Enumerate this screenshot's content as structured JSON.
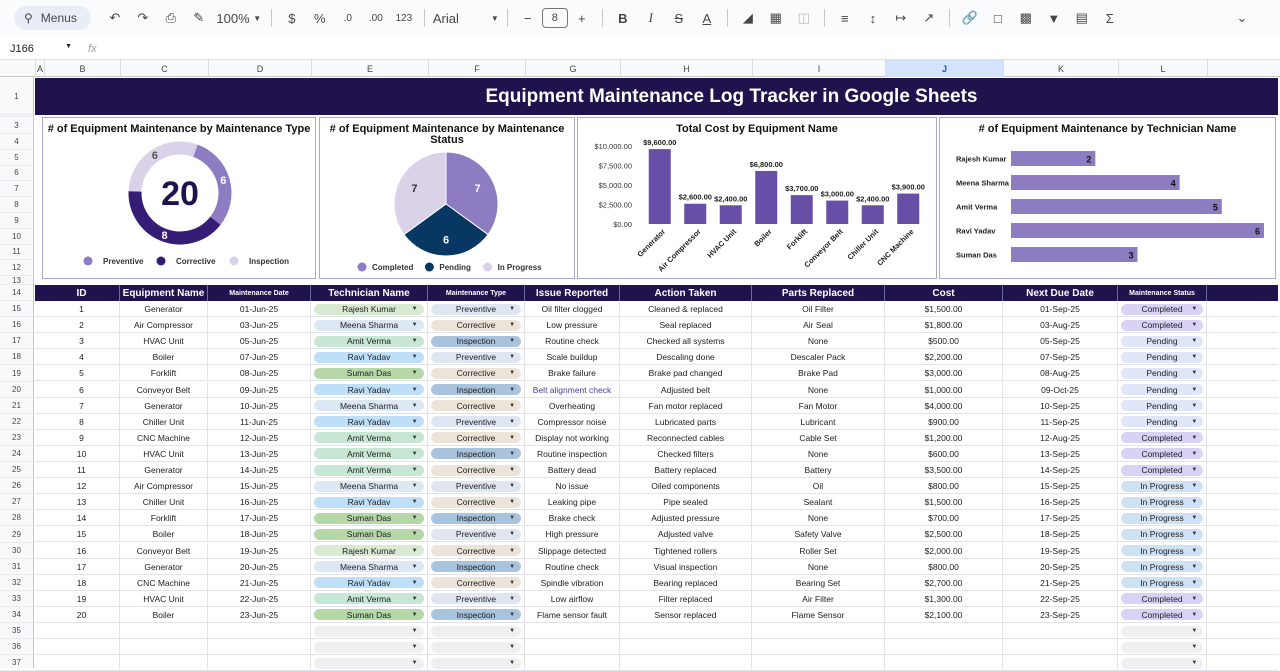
{
  "toolbar": {
    "menus_label": "Menus",
    "zoom": "100%",
    "currency": "$",
    "percent": "%",
    "decrease_decimal": ".0",
    "increase_decimal": ".00",
    "number_format": "123",
    "font": "Arial",
    "font_size": "8"
  },
  "formula_bar": {
    "cell_ref": "J166",
    "fx": "fx"
  },
  "columns": [
    {
      "letter": "A",
      "w": 9
    },
    {
      "letter": "B",
      "w": 76
    },
    {
      "letter": "C",
      "w": 88
    },
    {
      "letter": "D",
      "w": 103
    },
    {
      "letter": "E",
      "w": 117
    },
    {
      "letter": "F",
      "w": 97
    },
    {
      "letter": "G",
      "w": 95
    },
    {
      "letter": "H",
      "w": 132
    },
    {
      "letter": "I",
      "w": 133
    },
    {
      "letter": "J",
      "w": 118
    },
    {
      "letter": "K",
      "w": 115
    },
    {
      "letter": "L",
      "w": 89
    },
    {
      "letter": "",
      "w": 88
    }
  ],
  "selected_column": "J",
  "title": "Equipment Maintenance Log Tracker in Google Sheets",
  "charts": {
    "type_donut": {
      "title": "# of Equipment Maintenance by Maintenance Type",
      "total": "20",
      "segments": [
        {
          "name": "Preventive",
          "value": 6,
          "color": "#8e7cc3"
        },
        {
          "name": "Corrective",
          "value": 8,
          "color": "#351c75"
        },
        {
          "name": "Inspection",
          "value": 6,
          "color": "#d9d2e9"
        }
      ]
    },
    "status_pie": {
      "title_line1": "# of Equipment Maintenance by Maintenance",
      "title_line2": "Status",
      "segments": [
        {
          "name": "Completed",
          "value": 7,
          "color": "#8e7cc3"
        },
        {
          "name": "Pending",
          "value": 6,
          "color": "#073763"
        },
        {
          "name": "In Progress",
          "value": 7,
          "color": "#d9d2e9"
        }
      ]
    },
    "cost_bar": {
      "title": "Total Cost by Equipment Name",
      "yticks": [
        "$0.00",
        "$2,500.00",
        "$5,000.00",
        "$7,500.00",
        "$10,000.00"
      ],
      "ymax": 10000,
      "color": "#674ea7",
      "items": [
        {
          "name": "Generator",
          "value": 9600,
          "label": "$9,600.00"
        },
        {
          "name": "Air Compressor",
          "value": 2600,
          "label": "$2,600.00"
        },
        {
          "name": "HVAC Unit",
          "value": 2400,
          "label": "$2,400.00"
        },
        {
          "name": "Boiler",
          "value": 6800,
          "label": "$6,800.00"
        },
        {
          "name": "Forklift",
          "value": 3700,
          "label": "$3,700.00"
        },
        {
          "name": "Conveyor Belt",
          "value": 3000,
          "label": "$3,000.00"
        },
        {
          "name": "Chiller Unit",
          "value": 2400,
          "label": "$2,400.00"
        },
        {
          "name": "CNC Machine",
          "value": 3900,
          "label": "$3,900.00"
        }
      ]
    },
    "tech_bar": {
      "title": "# of Equipment Maintenance by Technician Name",
      "xmax": 6,
      "color": "#8e7cc3",
      "items": [
        {
          "name": "Rajesh Kumar",
          "value": 2
        },
        {
          "name": "Meena Sharma",
          "value": 4
        },
        {
          "name": "Amit Verma",
          "value": 5
        },
        {
          "name": "Ravi Yadav",
          "value": 6
        },
        {
          "name": "Suman Das",
          "value": 3
        }
      ]
    }
  },
  "table": {
    "headers": [
      "ID",
      "Equipment Name",
      "Maintenance Date",
      "Technician Name",
      "Maintenance Type",
      "Issue Reported",
      "Action Taken",
      "Parts Replaced",
      "Cost",
      "Next Due Date",
      "Maintenance Status"
    ],
    "tech_colors": {
      "Rajesh Kumar": "#d9ead3",
      "Meena Sharma": "#dde8f5",
      "Amit Verma": "#c8e6d4",
      "Ravi Yadav": "#bfdef7",
      "Suman Das": "#b6d7a8"
    },
    "type_colors": {
      "Preventive": "#dfe6f2",
      "Corrective": "#ece4d8",
      "Inspection": "#a9c3dd"
    },
    "status_colors": {
      "Completed": "#d9d2f5",
      "Pending": "#dfe6f8",
      "In Progress": "#cfe2f3"
    },
    "rows": [
      [
        "1",
        "Generator",
        "01-Jun-25",
        "Rajesh Kumar",
        "Preventive",
        "Oil filter clogged",
        "Cleaned & replaced",
        "Oil Filter",
        "$1,500.00",
        "01-Sep-25",
        "Completed"
      ],
      [
        "2",
        "Air Compressor",
        "03-Jun-25",
        "Meena Sharma",
        "Corrective",
        "Low pressure",
        "Seal replaced",
        "Air Seal",
        "$1,800.00",
        "03-Aug-25",
        "Completed"
      ],
      [
        "3",
        "HVAC Unit",
        "05-Jun-25",
        "Amit Verma",
        "Inspection",
        "Routine check",
        "Checked all systems",
        "None",
        "$500.00",
        "05-Sep-25",
        "Pending"
      ],
      [
        "4",
        "Boiler",
        "07-Jun-25",
        "Ravi Yadav",
        "Preventive",
        "Scale buildup",
        "Descaling done",
        "Descaler Pack",
        "$2,200.00",
        "07-Sep-25",
        "Pending"
      ],
      [
        "5",
        "Forklift",
        "08-Jun-25",
        "Suman Das",
        "Corrective",
        "Brake failure",
        "Brake pad changed",
        "Brake Pad",
        "$3,000.00",
        "08-Aug-25",
        "Pending"
      ],
      [
        "6",
        "Conveyor Belt",
        "09-Jun-25",
        "Ravi Yadav",
        "Inspection",
        "Belt alignment check",
        "Adjusted belt",
        "None",
        "$1,000.00",
        "09-Oct-25",
        "Pending"
      ],
      [
        "7",
        "Generator",
        "10-Jun-25",
        "Meena Sharma",
        "Corrective",
        "Overheating",
        "Fan motor replaced",
        "Fan Motor",
        "$4,000.00",
        "10-Sep-25",
        "Pending"
      ],
      [
        "8",
        "Chiller Unit",
        "11-Jun-25",
        "Ravi Yadav",
        "Preventive",
        "Compressor noise",
        "Lubricated parts",
        "Lubricant",
        "$900.00",
        "11-Sep-25",
        "Pending"
      ],
      [
        "9",
        "CNC Machine",
        "12-Jun-25",
        "Amit Verma",
        "Corrective",
        "Display not working",
        "Reconnected cables",
        "Cable Set",
        "$1,200.00",
        "12-Aug-25",
        "Completed"
      ],
      [
        "10",
        "HVAC Unit",
        "13-Jun-25",
        "Amit Verma",
        "Inspection",
        "Routine inspection",
        "Checked filters",
        "None",
        "$600.00",
        "13-Sep-25",
        "Completed"
      ],
      [
        "11",
        "Generator",
        "14-Jun-25",
        "Amit Verma",
        "Corrective",
        "Battery dead",
        "Battery replaced",
        "Battery",
        "$3,500.00",
        "14-Sep-25",
        "Completed"
      ],
      [
        "12",
        "Air Compressor",
        "15-Jun-25",
        "Meena Sharma",
        "Preventive",
        "No issue",
        "Oiled components",
        "Oil",
        "$800.00",
        "15-Sep-25",
        "In Progress"
      ],
      [
        "13",
        "Chiller Unit",
        "16-Jun-25",
        "Ravi Yadav",
        "Corrective",
        "Leaking pipe",
        "Pipe sealed",
        "Sealant",
        "$1,500.00",
        "16-Sep-25",
        "In Progress"
      ],
      [
        "14",
        "Forklift",
        "17-Jun-25",
        "Suman Das",
        "Inspection",
        "Brake check",
        "Adjusted pressure",
        "None",
        "$700.00",
        "17-Sep-25",
        "In Progress"
      ],
      [
        "15",
        "Boiler",
        "18-Jun-25",
        "Suman Das",
        "Preventive",
        "High pressure",
        "Adjusted valve",
        "Safety Valve",
        "$2,500.00",
        "18-Sep-25",
        "In Progress"
      ],
      [
        "16",
        "Conveyor Belt",
        "19-Jun-25",
        "Rajesh Kumar",
        "Corrective",
        "Slippage detected",
        "Tightened rollers",
        "Roller Set",
        "$2,000.00",
        "19-Sep-25",
        "In Progress"
      ],
      [
        "17",
        "Generator",
        "20-Jun-25",
        "Meena Sharma",
        "Inspection",
        "Routine check",
        "Visual inspection",
        "None",
        "$800.00",
        "20-Sep-25",
        "In Progress"
      ],
      [
        "18",
        "CNC Machine",
        "21-Jun-25",
        "Ravi Yadav",
        "Corrective",
        "Spindle vibration",
        "Bearing replaced",
        "Bearing Set",
        "$2,700.00",
        "21-Sep-25",
        "In Progress"
      ],
      [
        "19",
        "HVAC Unit",
        "22-Jun-25",
        "Amit Verma",
        "Preventive",
        "Low airflow",
        "Filter replaced",
        "Air Filter",
        "$1,300.00",
        "22-Sep-25",
        "Completed"
      ],
      [
        "20",
        "Boiler",
        "23-Jun-25",
        "Suman Das",
        "Inspection",
        "Flame sensor fault",
        "Sensor replaced",
        "Flame Sensor",
        "$2,100.00",
        "23-Sep-25",
        "Completed"
      ]
    ],
    "empty_rows": 3
  }
}
